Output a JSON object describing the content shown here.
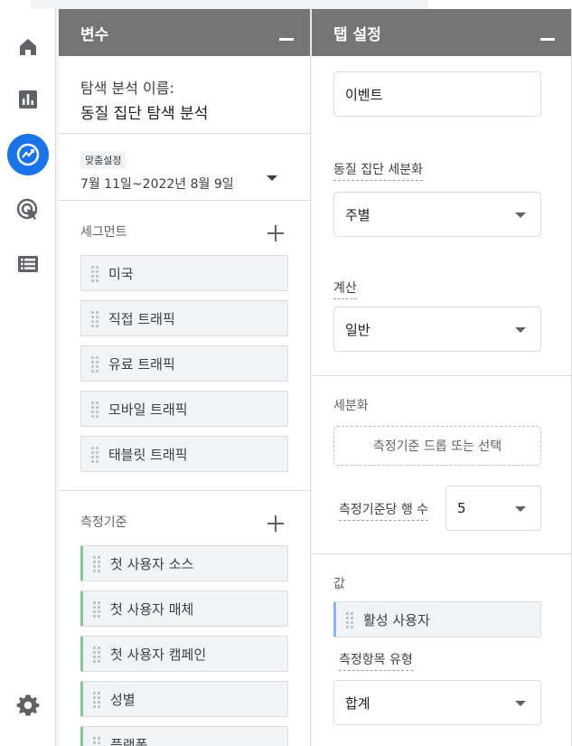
{
  "nav": {
    "items": [
      {
        "icon": "home-icon"
      },
      {
        "icon": "reports-icon"
      },
      {
        "icon": "explore-icon",
        "active": true
      },
      {
        "icon": "advertising-icon"
      },
      {
        "icon": "configure-list-icon"
      }
    ],
    "settings_icon": "gear-icon",
    "active_color": "#1a73e8"
  },
  "variables": {
    "title": "변수",
    "exploration_name_label": "탐색 분석 이름:",
    "exploration_name": "동질 집단 탐색 분석",
    "date_badge": "맞춤설정",
    "date_range": "7월 11일~2022년 8월 9일",
    "segments_label": "세그먼트",
    "segments": [
      "미국",
      "직접 트래픽",
      "유료 트래픽",
      "모바일 트래픽",
      "태블릿 트래픽"
    ],
    "dimensions_label": "측정기준",
    "dimensions": [
      "첫 사용자 소스",
      "첫 사용자 매체",
      "첫 사용자 캠페인",
      "성별",
      "플랫폼"
    ]
  },
  "tab_settings": {
    "title": "탭 설정",
    "return_criteria_value": "이벤트",
    "cohort_granularity_label": "동질 집단 세분화",
    "cohort_granularity_value": "주별",
    "calculation_label": "계산",
    "calculation_value": "일반",
    "breakdown_label": "세분화",
    "breakdown_dropzone": "측정기준 드롭 또는 선택",
    "rows_per_dimension_label": "측정기준당 행 수",
    "rows_per_dimension_value": "5",
    "values_label": "값",
    "value_metric": "활성 사용자",
    "metric_type_label": "측정항목 유형",
    "metric_type_value": "합계"
  }
}
